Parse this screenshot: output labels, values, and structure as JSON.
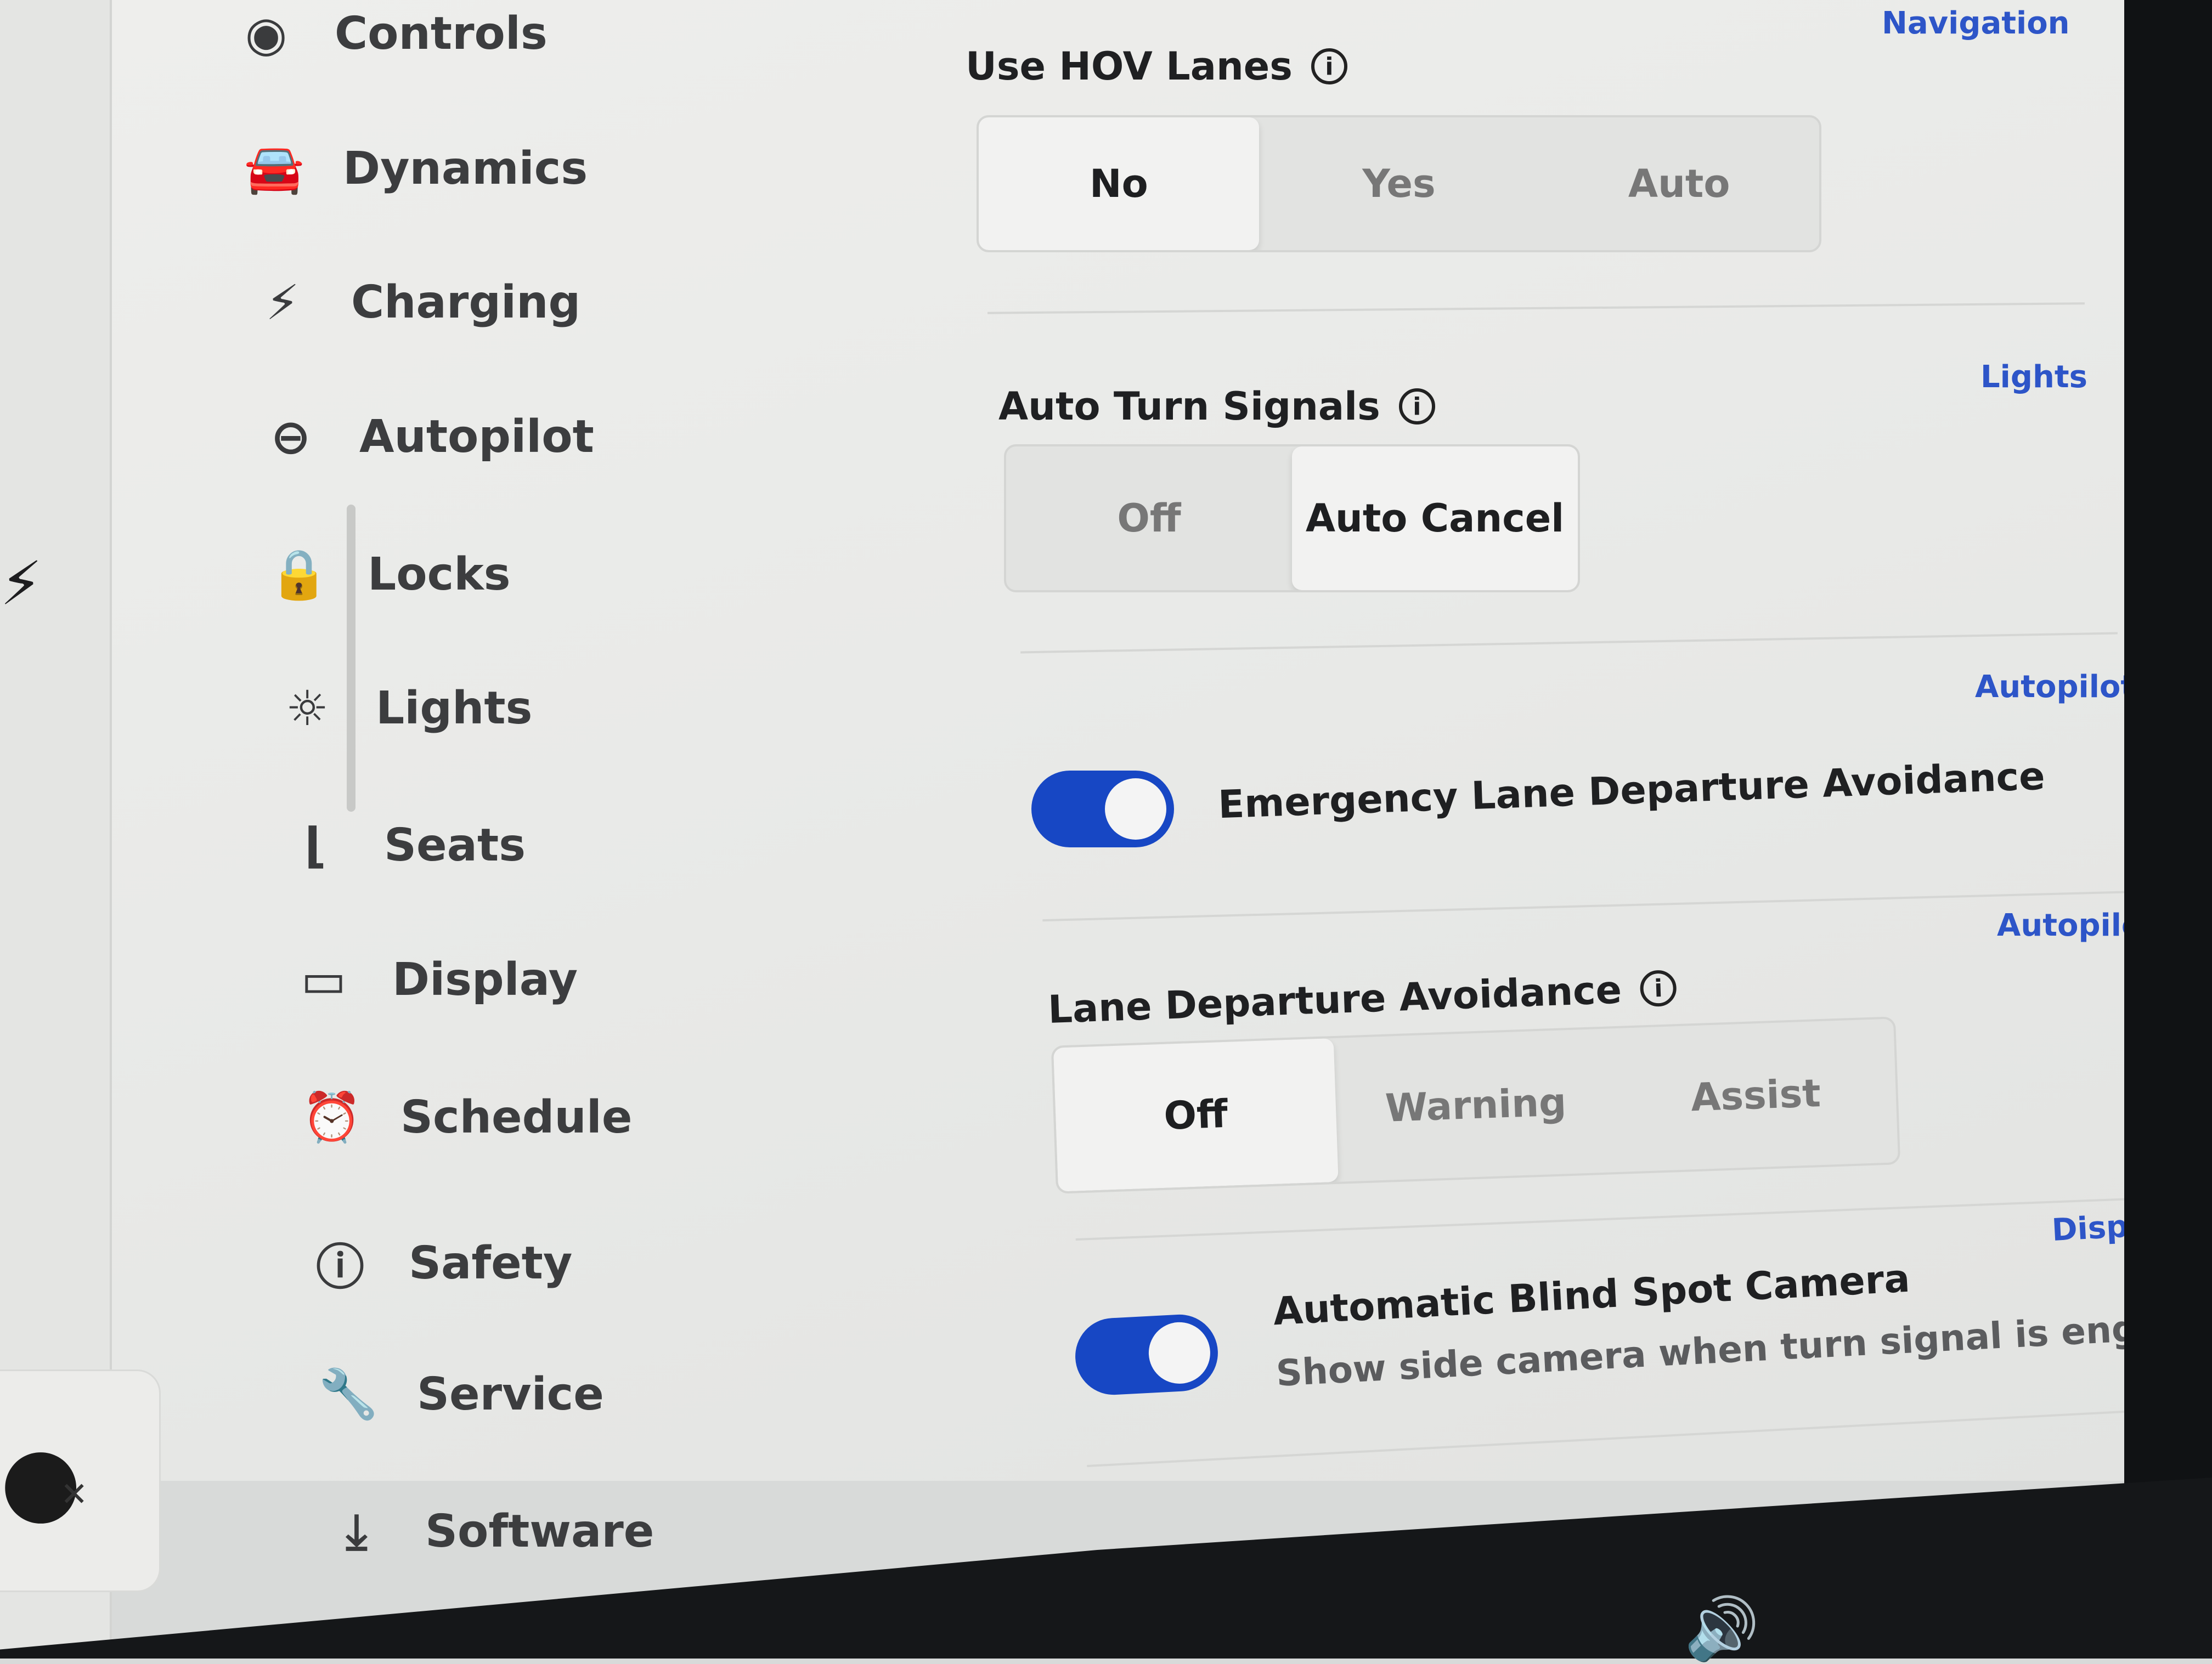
{
  "sidebar": {
    "items": [
      {
        "label": "Controls",
        "icon": "toggle-icon"
      },
      {
        "label": "Dynamics",
        "icon": "car-icon"
      },
      {
        "label": "Charging",
        "icon": "bolt-icon"
      },
      {
        "label": "Autopilot",
        "icon": "steering-wheel-icon"
      },
      {
        "label": "Locks",
        "icon": "lock-icon"
      },
      {
        "label": "Lights",
        "icon": "sun-icon"
      },
      {
        "label": "Seats",
        "icon": "seat-icon"
      },
      {
        "label": "Display",
        "icon": "display-icon"
      },
      {
        "label": "Schedule",
        "icon": "clock-icon"
      },
      {
        "label": "Safety",
        "icon": "alert-icon"
      },
      {
        "label": "Service",
        "icon": "wrench-icon"
      },
      {
        "label": "Software",
        "icon": "download-icon"
      }
    ]
  },
  "settings": {
    "hov": {
      "label": "Use HOV Lanes",
      "category": "Navigation",
      "options": [
        "No",
        "Yes",
        "Auto"
      ],
      "selected": "No"
    },
    "turn_signals": {
      "label": "Auto Turn Signals",
      "category": "Lights",
      "options": [
        "Off",
        "Auto Cancel"
      ],
      "selected": "Auto Cancel"
    },
    "elda": {
      "label": "Emergency Lane Departure Avoidance",
      "category": "Autopilot",
      "enabled": true
    },
    "lda": {
      "label": "Lane Departure Avoidance",
      "category": "Autopilot",
      "options": [
        "Off",
        "Warning",
        "Assist"
      ],
      "selected": "Off"
    },
    "blind_spot": {
      "label": "Automatic Blind Spot Camera",
      "sublabel": "Show side camera when turn signal is engaged",
      "category": "Display",
      "enabled": true
    }
  },
  "colors": {
    "accent": "#1747c4",
    "link": "#2d55c8",
    "screen_bg": "#ebebea"
  }
}
